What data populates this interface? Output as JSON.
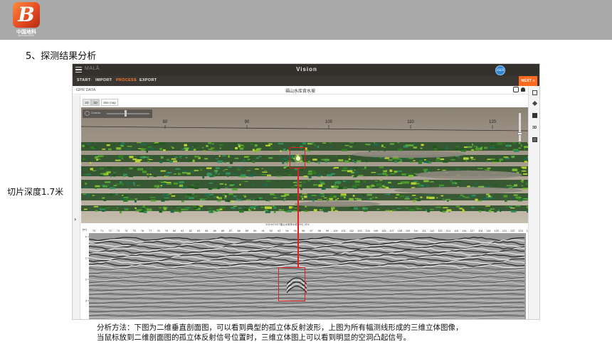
{
  "header": {
    "logo_text_cn": "中国地科",
    "logo_text_en": "ZHONGDIKE",
    "logo_letter": "B"
  },
  "slide": {
    "title": "5、探测结果分析",
    "side_caption": "切片深度1.7米"
  },
  "app": {
    "brand": "MALÅ",
    "title": "Vision",
    "user_badge": "USER",
    "steps": [
      "START",
      "IMPORT",
      "PROCESS",
      "EXPORT"
    ],
    "active_step": "PROCESS",
    "next_label": "NEXT",
    "panel_label": "GPR DATA",
    "panel_title": "福山水库背水坡",
    "view_tabs": [
      "2D",
      "3D",
      "Site map"
    ],
    "toolbox_label": "Controls",
    "profile_file": "2024/03/07福山水库背水坡_003_004",
    "depth_unit": "[m]",
    "icons": [
      "menu-icon",
      "fit-icon",
      "bell-icon",
      "gear-icon",
      "layers-icon",
      "pin-icon",
      "chart-icon",
      "3d-icon",
      "map-icon",
      "chevron-right-icon"
    ]
  },
  "viewer3d": {
    "x_ticks": [
      "80",
      "90",
      "100",
      "110",
      "120"
    ]
  },
  "profile": {
    "x_ticks": [
      "70",
      "71",
      "72",
      "73",
      "74",
      "75",
      "76",
      "77",
      "78",
      "79",
      "80",
      "81",
      "82",
      "83",
      "84",
      "85",
      "86",
      "87",
      "88",
      "89",
      "90",
      "91",
      "92",
      "93",
      "94",
      "95",
      "96",
      "97",
      "98",
      "99",
      "100",
      "101",
      "102",
      "103",
      "104",
      "105",
      "106",
      "107",
      "108",
      "109",
      "110",
      "111",
      "112",
      "113",
      "114",
      "115",
      "116",
      "117",
      "118",
      "119",
      "120",
      "121",
      "122",
      "123",
      "124"
    ],
    "depth_ticks": [
      "0",
      "1",
      "2",
      "3"
    ]
  },
  "colors": {
    "banner": "#a9a9a9",
    "accent": "#ff6a1f",
    "highlight": "#e02020"
  },
  "analysis": {
    "line1": "分析方法：下图为二维垂直剖面图，可以看到典型的孤立体反射波形，上图为所有幅测线形成的三维立体图像，",
    "line2": "当鼠标放到二维剖面图的孤立体反射信号位置时，三维立体图上可以看到明显的空洞凸起信号。"
  }
}
